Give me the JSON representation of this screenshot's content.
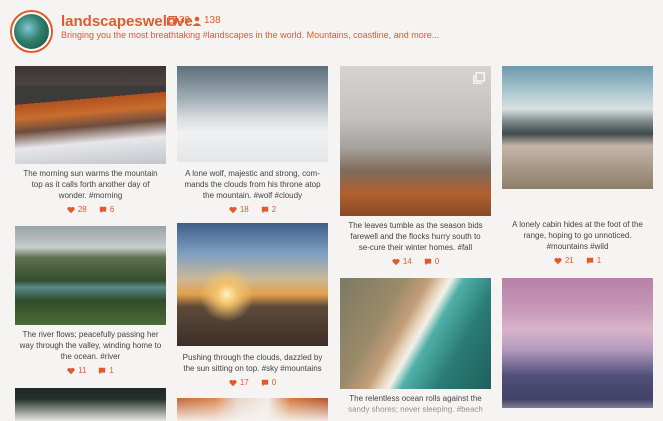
{
  "profile": {
    "handle": "landscapeswelove",
    "posts_count": "39",
    "followers_count": "138",
    "bio": "Bringing you the most breathtaking #landscapes in the world. Mountains, coastline, and more..."
  },
  "icons": {
    "posts": "photos-icon",
    "followers": "user-icon",
    "likes": "heart-icon",
    "comments": "comment-icon",
    "multi": "multiple-photos-icon"
  },
  "colors": {
    "accent": "#e15a2d",
    "background": "#f6f4f2",
    "text": "#444444"
  },
  "posts": [
    {
      "caption": "The morning sun warms the mountain top as it calls forth another day of wonder. #morning",
      "likes": "28",
      "comments": "6"
    },
    {
      "caption": "A lone wolf, majestic and strong, com-mands the clouds from his throne atop the mountain. #wolf #cloudy",
      "likes": "18",
      "comments": "2"
    },
    {
      "caption": "The leaves tumble as the season bids farewell and the flocks hurry south to se-cure their winter homes. #fall",
      "likes": "14",
      "comments": "0"
    },
    {
      "caption": "A lonely cabin hides at the foot of the range, hoping to go unnoticed. #mountains #wild",
      "likes": "21",
      "comments": "1"
    },
    {
      "caption": "The river flows; peacefully passing her way through the valley, winding home to the ocean. #river",
      "likes": "11",
      "comments": "1"
    },
    {
      "caption": "Pushing through the clouds, dazzled by the sun sitting on top. #sky #mountains",
      "likes": "17",
      "comments": "0"
    },
    {
      "caption": "The relentless ocean rolls against the sandy shores; never sleeping. #beach"
    }
  ]
}
